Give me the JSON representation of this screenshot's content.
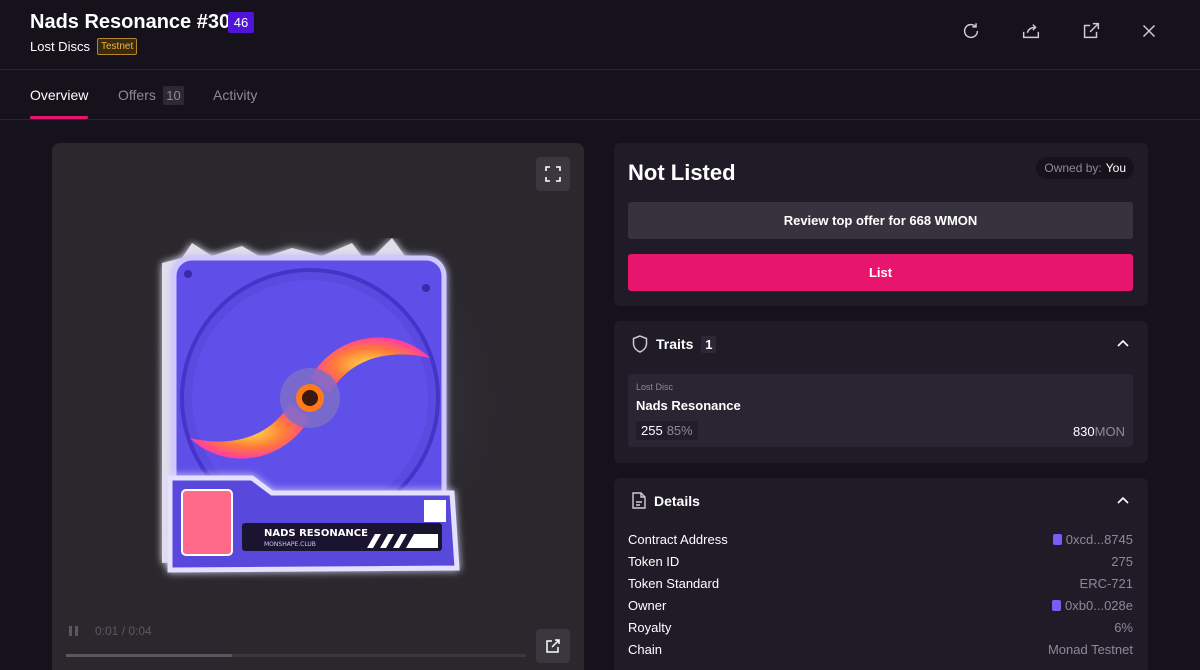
{
  "header": {
    "title": "Nads Resonance #30",
    "rank": "46",
    "collection": "Lost Discs",
    "network_badge": "Testnet"
  },
  "tabs": [
    {
      "label": "Overview"
    },
    {
      "label": "Offers",
      "count": "10"
    },
    {
      "label": "Activity"
    }
  ],
  "media": {
    "time": "0:01 / 0:04",
    "progress": 0.36,
    "art_text": {
      "title": "NADS RESONANCE",
      "subtitle": "MONSHAPE.CLUB"
    }
  },
  "listing": {
    "status": "Not Listed",
    "owned_label": "Owned by:",
    "owner": "You",
    "review_button": "Review top offer for 668 WMON",
    "list_button": "List"
  },
  "traits": {
    "heading": "Traits",
    "count": "1",
    "items": [
      {
        "type": "Lost Disc",
        "value": "Nads Resonance",
        "count": "255",
        "pct": "85%",
        "price": "830",
        "unit": "MON"
      }
    ]
  },
  "details": {
    "heading": "Details",
    "rows": [
      {
        "label": "Contract Address",
        "value": "0xcd...8745"
      },
      {
        "label": "Token ID",
        "value": "275"
      },
      {
        "label": "Token Standard",
        "value": "ERC-721"
      },
      {
        "label": "Owner",
        "value": "0xb0...028e"
      },
      {
        "label": "Royalty",
        "value": "6%"
      },
      {
        "label": "Chain",
        "value": "Monad Testnet"
      }
    ]
  },
  "colors": {
    "accent": "#e8156e",
    "rank_badge": "#4f14d8",
    "testnet": "#f3b53a"
  }
}
